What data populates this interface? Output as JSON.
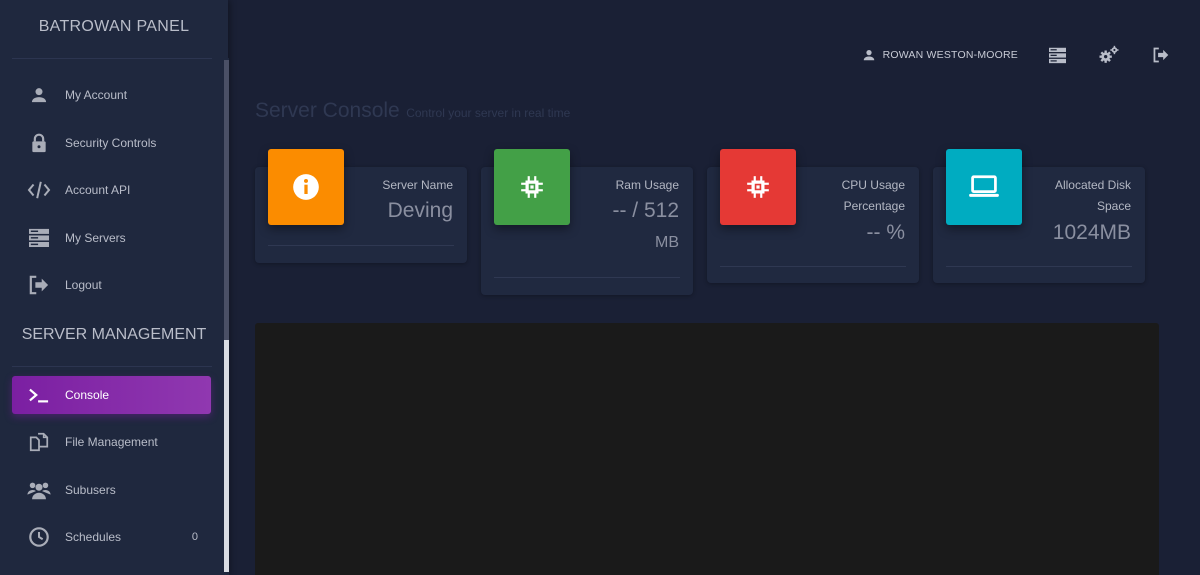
{
  "brand": "BATROWAN PANEL",
  "sidebar": {
    "account_items": [
      {
        "label": "My Account",
        "icon": "user-icon"
      },
      {
        "label": "Security Controls",
        "icon": "lock-icon"
      },
      {
        "label": "Account API",
        "icon": "code-icon"
      },
      {
        "label": "My Servers",
        "icon": "server-icon"
      },
      {
        "label": "Logout",
        "icon": "logout-icon"
      }
    ],
    "section_title": "SERVER MANAGEMENT",
    "server_items": [
      {
        "label": "Console",
        "icon": "terminal-icon",
        "active": true
      },
      {
        "label": "File Management",
        "icon": "files-icon"
      },
      {
        "label": "Subusers",
        "icon": "users-icon"
      },
      {
        "label": "Schedules",
        "icon": "clock-icon",
        "badge": "0"
      }
    ]
  },
  "topbar": {
    "user_name": "ROWAN WESTON-MOORE",
    "icons": [
      "user-icon",
      "server-icon",
      "gears-icon",
      "logout-icon"
    ]
  },
  "page": {
    "title": "Server Console",
    "subtitle": "Control your server in real time"
  },
  "cards": [
    {
      "category": "Server Name",
      "value": "Deving",
      "color": "#fb8c00",
      "icon": "info-icon"
    },
    {
      "category": "Ram Usage",
      "value_line1": "-- / 512",
      "value_line2": "MB",
      "color": "#43a047",
      "icon": "chip-icon"
    },
    {
      "category_line1": "CPU Usage",
      "category_line2": "Percentage",
      "value": "-- %",
      "color": "#e53935",
      "icon": "chip-icon"
    },
    {
      "category_line1": "Allocated Disk",
      "category_line2": "Space",
      "value": "1024MB",
      "color": "#00acc1",
      "icon": "laptop-icon"
    }
  ],
  "colors": {
    "background": "#1a2035",
    "sidebar": "#1f283e",
    "active_item": "#7b1fa2",
    "console": "#1a1a1a"
  }
}
